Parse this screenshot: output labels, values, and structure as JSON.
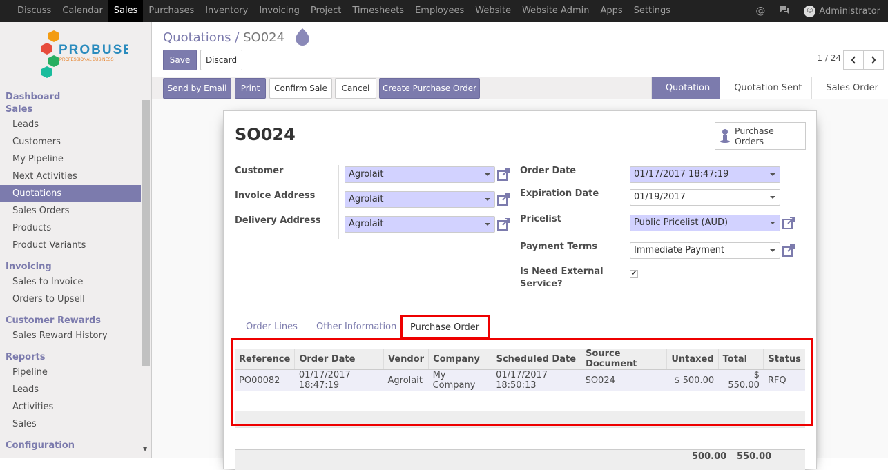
{
  "topbar": {
    "menu": [
      "Discuss",
      "Calendar",
      "Sales",
      "Purchases",
      "Inventory",
      "Invoicing",
      "Project",
      "Timesheets",
      "Employees",
      "Website",
      "Website Admin",
      "Apps",
      "Settings"
    ],
    "active_menu": "Sales",
    "user": "Administrator",
    "icons": [
      "at-icon",
      "chat-icon"
    ]
  },
  "logo": {
    "name": "PROBUSE",
    "tagline": "PROFESSIONAL BUSINESS"
  },
  "sidebar": {
    "sections": [
      {
        "head": "Dashboard",
        "items": []
      },
      {
        "head": "Sales",
        "items": [
          "Leads",
          "Customers",
          "My Pipeline",
          "Next Activities",
          "Quotations",
          "Sales Orders",
          "Products",
          "Product Variants"
        ]
      },
      {
        "head": "Invoicing",
        "items": [
          "Sales to Invoice",
          "Orders to Upsell"
        ]
      },
      {
        "head": "Customer Rewards",
        "items": [
          "Sales Reward History"
        ]
      },
      {
        "head": "Reports",
        "items": [
          "Pipeline",
          "Leads",
          "Activities",
          "Sales"
        ]
      },
      {
        "head": "Configuration",
        "items": []
      }
    ],
    "active_item": "Quotations"
  },
  "breadcrumb": {
    "parent": "Quotations",
    "separator": "/",
    "current": "SO024"
  },
  "buttons": {
    "save": "Save",
    "discard": "Discard",
    "send_email": "Send by Email",
    "print": "Print",
    "confirm": "Confirm Sale",
    "cancel": "Cancel",
    "create_po": "Create Purchase Order"
  },
  "pager": {
    "value": "1 / 24"
  },
  "stages": [
    "Quotation",
    "Quotation Sent",
    "Sales Order"
  ],
  "active_stage": "Quotation",
  "form": {
    "title": "SO024",
    "smart_button": {
      "line1": "Purchase",
      "line2": "Orders"
    },
    "customer": {
      "label": "Customer",
      "value": "Agrolait"
    },
    "invoice_address": {
      "label": "Invoice Address",
      "value": "Agrolait"
    },
    "delivery_address": {
      "label": "Delivery Address",
      "value": "Agrolait"
    },
    "order_date": {
      "label": "Order Date",
      "value": "01/17/2017 18:47:19"
    },
    "expiration_date": {
      "label": "Expiration Date",
      "value": "01/19/2017"
    },
    "pricelist": {
      "label": "Pricelist",
      "value": "Public Pricelist (AUD)"
    },
    "payment_terms": {
      "label": "Payment Terms",
      "value": "Immediate Payment"
    },
    "external_service": {
      "label_line1": "Is Need External",
      "label_line2": "Service?",
      "checked": true
    }
  },
  "tabs": [
    "Order Lines",
    "Other Information",
    "Purchase Order"
  ],
  "active_tab": "Purchase Order",
  "po_table": {
    "columns": [
      "Reference",
      "Order Date",
      "Vendor",
      "Company",
      "Scheduled Date",
      "Source Document",
      "Untaxed",
      "Total",
      "Status"
    ],
    "rows": [
      [
        "PO00082",
        "01/17/2017 18:47:19",
        "Agrolait",
        "My Company",
        "01/17/2017 18:50:13",
        "SO024",
        "$ 500.00",
        "$ 550.00",
        "RFQ"
      ]
    ]
  },
  "totals_partial": {
    "untaxed": "500.00",
    "total": "550.00"
  },
  "colors": {
    "accent": "#7c7bad",
    "highlight": "#e00000",
    "topbar": "#222222",
    "required_field": "#d2d2ff"
  }
}
